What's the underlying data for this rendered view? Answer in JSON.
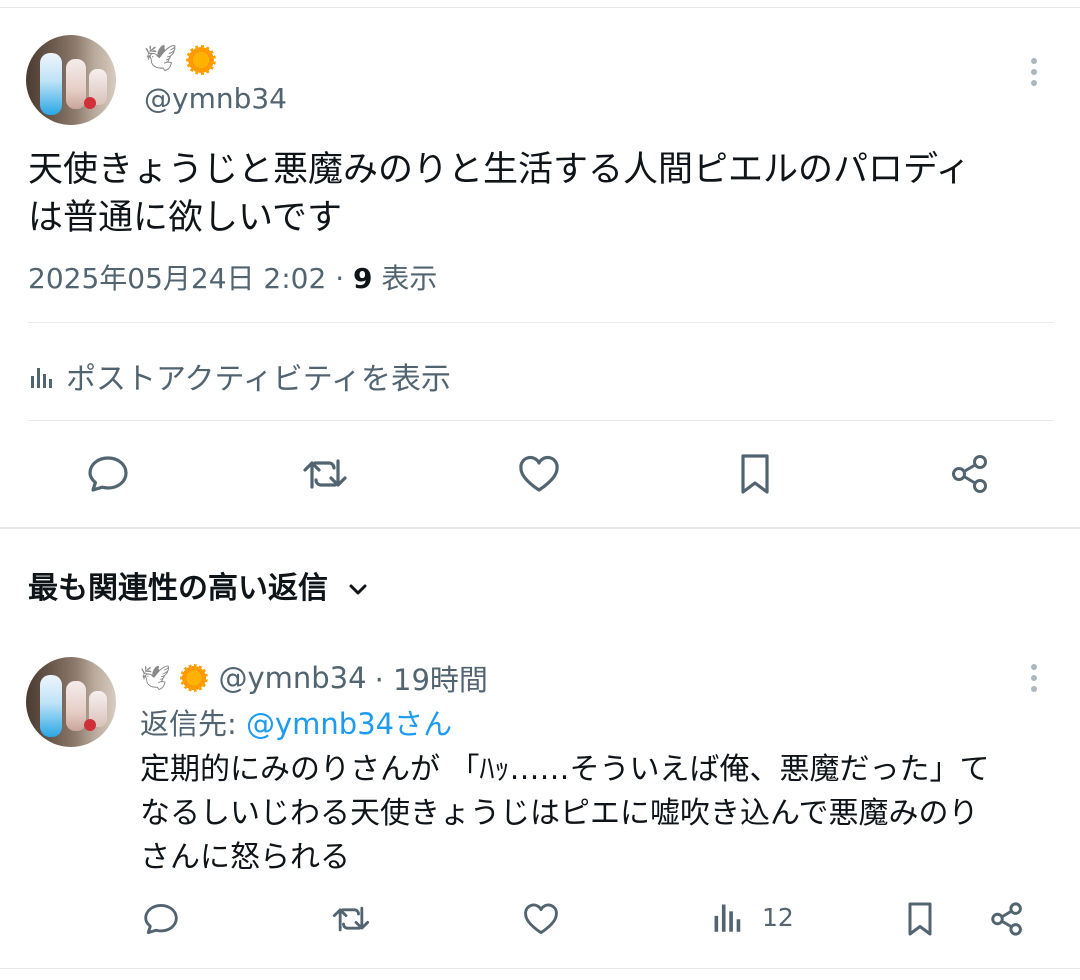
{
  "post": {
    "display_name_emojis": [
      "dove-emoji",
      "sunflower-emoji"
    ],
    "handle": "@ymnb34",
    "text_line1": "天使きょうじと悪魔みのりと生活する人間ピエルのパロディ",
    "text_line2": "は普通に欲しいです",
    "timestamp": "2025年05月24日 2:02",
    "separator": "·",
    "views_count": "9",
    "views_label": "表示",
    "activity_label": "ポストアクティビティを表示"
  },
  "actions": [
    "reply-icon",
    "repost-icon",
    "like-icon",
    "bookmark-icon",
    "share-icon"
  ],
  "replies_sort_label": "最も関連性の高い返信",
  "reply": {
    "handle": "@ymnb34",
    "time": "· 19時間",
    "reply_to_prefix": "返信先:",
    "reply_to_handle": "@ymnb34さん",
    "text_line1": "定期的にみのりさんが 「ﾊｯ……そういえば俺、悪魔だった」て",
    "text_line2": "なるしいじわる天使きょうじはピエに嘘吹き込んで悪魔みのり",
    "text_line3": "さんに怒られる",
    "views_count": "12"
  },
  "colors": {
    "text": "#0f1419",
    "secondary": "#536471",
    "link": "#1d9bf0",
    "divider": "#e7e9ea"
  }
}
